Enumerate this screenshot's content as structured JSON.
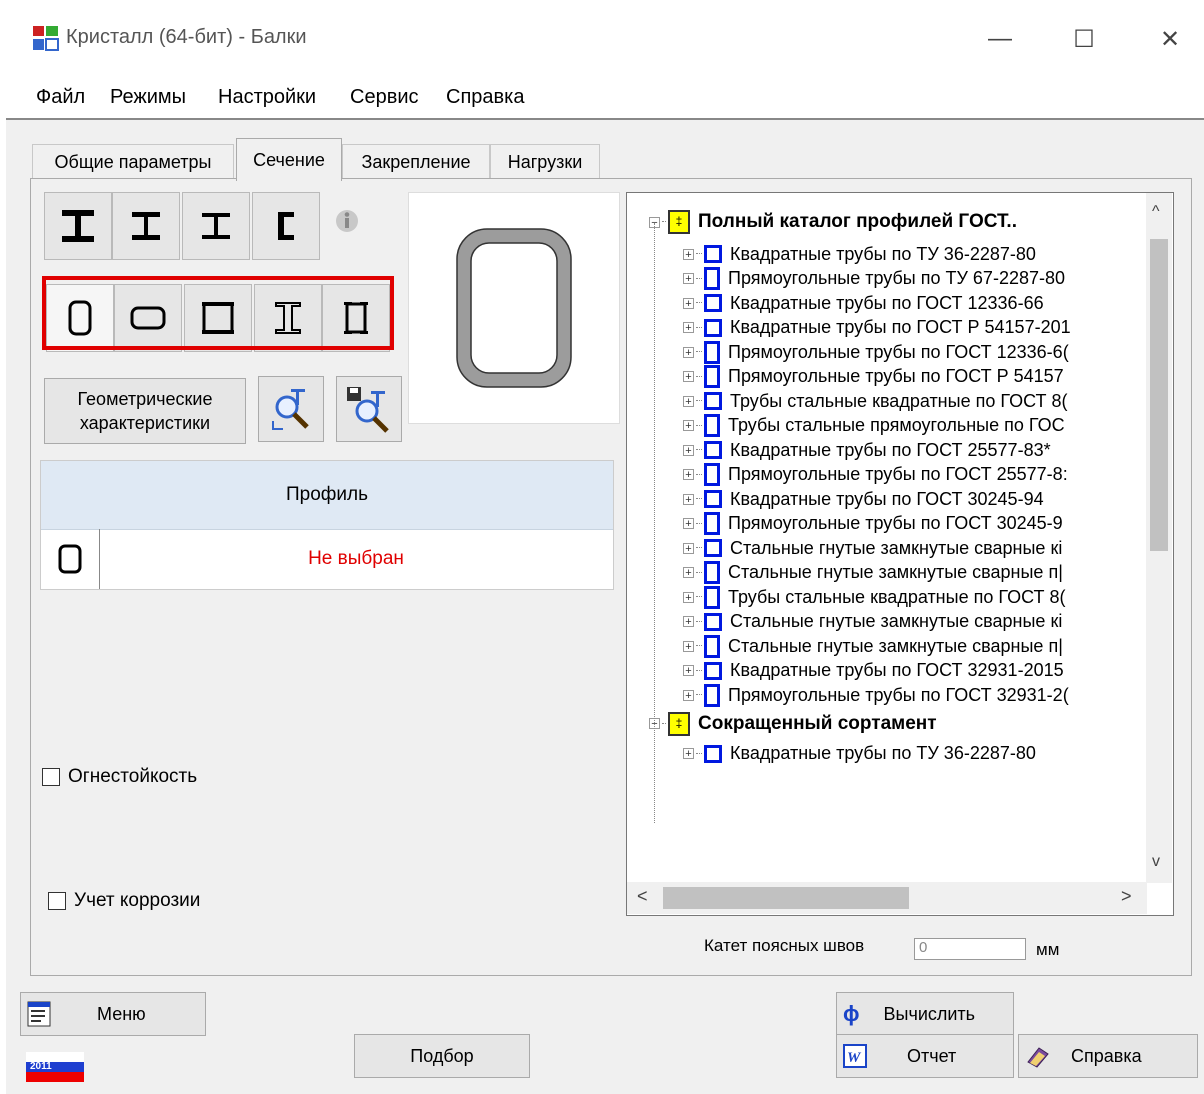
{
  "window": {
    "title": "Кристалл (64-бит) - Балки",
    "minimize_label": "—",
    "maximize_label": "☐",
    "close_label": "✕"
  },
  "menu": [
    "Файл",
    "Режимы",
    "Настройки",
    "Сервис",
    "Справка"
  ],
  "tabs": [
    "Общие параметры",
    "Сечение",
    "Закрепление",
    "Нагрузки"
  ],
  "active_tab": "Сечение",
  "geo_button": {
    "line1": "Геометрические",
    "line2": "характеристики"
  },
  "profile_table": {
    "header": "Профиль",
    "value": "Не выбран"
  },
  "checkboxes": {
    "fire": "Огнестойкость",
    "corrosion": "Учет коррозии"
  },
  "tree": {
    "root1": "Полный каталог профилей ГОСТ..",
    "items": [
      {
        "shape": "square",
        "label": "Квадратные трубы по ТУ 36-2287-80"
      },
      {
        "shape": "rect",
        "label": "Прямоугольные трубы по ТУ 67-2287-80"
      },
      {
        "shape": "square",
        "label": "Квадратные трубы по ГОСТ 12336-66"
      },
      {
        "shape": "square",
        "label": "Квадратные трубы по ГОСТ Р 54157-201"
      },
      {
        "shape": "rect",
        "label": "Прямоугольные трубы по ГОСТ 12336-6("
      },
      {
        "shape": "rect",
        "label": "Прямоугольные трубы по ГОСТ Р 54157"
      },
      {
        "shape": "square",
        "label": "Трубы стальные квадратные по ГОСТ 8("
      },
      {
        "shape": "rect",
        "label": "Трубы стальные прямоугольные по ГОС"
      },
      {
        "shape": "square",
        "label": "Квадратные трубы по ГОСТ 25577-83*"
      },
      {
        "shape": "rect",
        "label": "Прямоугольные трубы по ГОСТ 25577-8:"
      },
      {
        "shape": "square",
        "label": "Квадратные трубы по ГОСТ 30245-94"
      },
      {
        "shape": "rect",
        "label": "Прямоугольные трубы по ГОСТ 30245-9"
      },
      {
        "shape": "square",
        "label": "Стальные гнутые замкнутые сварные кі"
      },
      {
        "shape": "rect",
        "label": "Стальные гнутые замкнутые сварные п|"
      },
      {
        "shape": "rect",
        "label": "Трубы стальные квадратные по ГОСТ 8("
      },
      {
        "shape": "square",
        "label": "Стальные гнутые замкнутые сварные кі"
      },
      {
        "shape": "rect",
        "label": "Стальные гнутые замкнутые сварные п|"
      },
      {
        "shape": "square",
        "label": "Квадратные трубы по ГОСТ 32931-2015"
      },
      {
        "shape": "rect",
        "label": "Прямоугольные трубы по ГОСТ 32931-2("
      }
    ],
    "root2": "Сокращенный сортамент",
    "root2_items": [
      {
        "shape": "square",
        "label": "Квадратные трубы по ТУ 36-2287-80"
      }
    ]
  },
  "weld": {
    "label": "Катет поясных швов",
    "value": "0",
    "unit": "мм"
  },
  "buttons": {
    "menu": "Меню",
    "select": "Подбор",
    "calc": "Вычислить",
    "report": "Отчет",
    "help": "Справка"
  },
  "version_badge": "2011",
  "colors": {
    "accent_blue": "#0018e0",
    "highlight_red": "#e00000",
    "catalog_yellow": "#ffff00"
  }
}
